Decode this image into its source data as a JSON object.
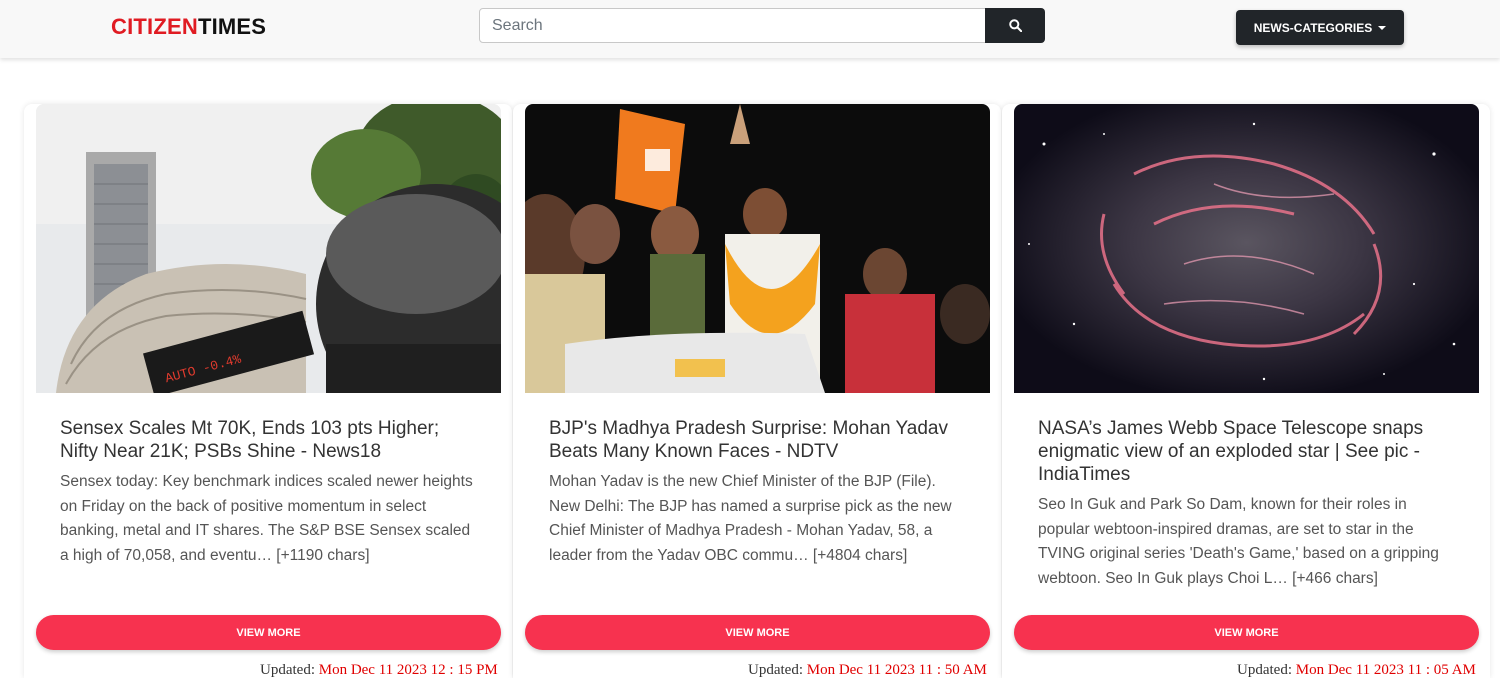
{
  "brand": {
    "part1": "CITIZEN",
    "part2": "TIMES"
  },
  "search": {
    "placeholder": "Search",
    "icon": "search-icon"
  },
  "categories_button": {
    "label": "NEWS-CATEGORIES",
    "icon": "caret-down-icon"
  },
  "colors": {
    "brand_red": "#e01b22",
    "button_pink": "#f7324f",
    "dark": "#212529",
    "date_red": "#e00000"
  },
  "articles": [
    {
      "title": "Sensex Scales Mt 70K, Ends 103 pts Higher; Nifty Near 21K; PSBs Shine - News18",
      "description": "Sensex today: Key benchmark indices scaled newer heights on Friday on the back of positive momentum in select banking, metal and IT shares. The S&P BSE Sensex scaled a high of 70,058, and eventu… [+1190 chars]",
      "button": "VIEW MORE",
      "updated_label": "Updated:",
      "updated_date": "Mon Dec 11 2023 12 : 15 PM"
    },
    {
      "title": "BJP's Madhya Pradesh Surprise: Mohan Yadav Beats Many Known Faces - NDTV",
      "description": "Mohan Yadav is the new Chief Minister of the BJP (File). New Delhi: The BJP has named a surprise pick as the new Chief Minister of Madhya Pradesh - Mohan Yadav, 58, a leader from the Yadav OBC commu… [+4804 chars]",
      "button": "VIEW MORE",
      "updated_label": "Updated:",
      "updated_date": "Mon Dec 11 2023 11 : 50 AM"
    },
    {
      "title": "NASA’s James Webb Space Telescope snaps enigmatic view of an exploded star | See pic - IndiaTimes",
      "description": "Seo In Guk and Park So Dam, known for their roles in popular webtoon-inspired dramas, are set to star in the TVING original series 'Death's Game,' based on a gripping webtoon. Seo In Guk plays Choi L… [+466 chars]",
      "button": "VIEW MORE",
      "updated_label": "Updated:",
      "updated_date": "Mon Dec 11 2023 11 : 05 AM"
    }
  ]
}
